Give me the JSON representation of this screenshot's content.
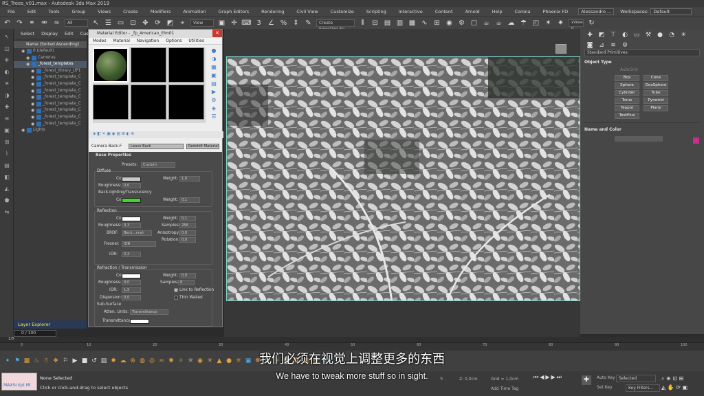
{
  "app": {
    "title": "RS_Trees_v01.max - Autodesk 3ds Max 2019"
  },
  "menubar": {
    "items": [
      "File",
      "Edit",
      "Tools",
      "Group",
      "Views",
      "Create",
      "Modifiers",
      "Animation",
      "Graph Editors",
      "Rendering",
      "Civil View",
      "Customize",
      "Scripting",
      "Interactive",
      "Content",
      "Arnold",
      "Help",
      "Corona",
      "Phoenix FD"
    ],
    "user": "Alessandro ...",
    "workspaces_label": "Workspaces:",
    "workspace_value": "Default"
  },
  "toolbar": {
    "filter_dd": "All",
    "view_dd": "View",
    "selection_set": "Create Selection Se",
    "xview": "xView: 0"
  },
  "scene_explorer": {
    "tabs": [
      "Select",
      "Display",
      "Edit",
      "Custo"
    ],
    "header": "Name (Sorted Ascending)",
    "rows": [
      {
        "label": "0 (default)",
        "indent": 1
      },
      {
        "label": "Cameras",
        "indent": 2
      },
      {
        "label": "_forest_templates",
        "indent": 2
      },
      {
        "label": "_forest_library_UP1",
        "indent": 3
      },
      {
        "label": "_forest_template_C",
        "indent": 3
      },
      {
        "label": "_forest_template_C",
        "indent": 3
      },
      {
        "label": "_forest_template_C",
        "indent": 3
      },
      {
        "label": "_forest_template_C",
        "indent": 3
      },
      {
        "label": "_forest_template_C",
        "indent": 3
      },
      {
        "label": "_forest_template_C",
        "indent": 3
      },
      {
        "label": "_forest_template_C",
        "indent": 3
      },
      {
        "label": "_forest_template_C",
        "indent": 3
      },
      {
        "label": "Lights",
        "indent": 1
      }
    ],
    "layer_explorer": "Layer Explorer",
    "frame": "0 / 100"
  },
  "material_editor": {
    "title": "Material Editor - _fp_American_Elm01",
    "menu": [
      "Modes",
      "Material",
      "Navigation",
      "Options",
      "Utilities"
    ],
    "name_label": "Camera Back-F",
    "material_name": "Leave Back",
    "material_type": "Redshift Material",
    "rollout": "Base Properties",
    "presets_label": "Presets:",
    "presets_value": "Custom",
    "diffuse": {
      "group": "Diffuse",
      "color_label": "Color:",
      "weight_label": "Weight:",
      "weight": "1,0",
      "roughness_label": "Roughness:",
      "roughness": "0,0"
    },
    "backlighting": {
      "group": "Back-lighting/Translucency",
      "color_label": "Color:",
      "weight_label": "Weight:",
      "weight": "0,1"
    },
    "reflection": {
      "group": "Reflection",
      "color_label": "Color:",
      "weight_label": "Weight:",
      "weight": "0,1",
      "roughness_label": "Roughness:",
      "roughness": "0,3",
      "samples_label": "Samples:",
      "samples": "256",
      "brdf_label": "BRDF:",
      "brdf": "Beck...nce)",
      "anisotropy_label": "Anisotropy:",
      "anisotropy": "0,0",
      "rotation_label": "Rotation:",
      "rotation": "0,0",
      "fresnel_label": "Fresnel:",
      "fresnel": "IOR",
      "ior_label": "IOR:",
      "ior": "2,2"
    },
    "refraction": {
      "group": "Refraction / Transmission",
      "color_label": "Color:",
      "weight_label": "Weight:",
      "weight": "0,0",
      "roughness_label": "Roughness:",
      "roughness": "0,0",
      "samples_label": "Samples:",
      "samples": "8",
      "ior_label": "IOR:",
      "ior": "1,5",
      "link_label": "Link to Reflection",
      "dispersion_label": "Dispersion:",
      "dispersion": "0,0",
      "thin_label": "Thin Walled"
    },
    "subsurface": {
      "group": "Sub-Surface",
      "atten_label": "Atten. Units:",
      "atten": "Transmittance",
      "transmittance_label": "Transmittance:"
    }
  },
  "command_panel": {
    "category": "Standard Primitives",
    "object_type": "Object Type",
    "autogrid": "AutoGrid",
    "objects": [
      "Box",
      "Cone",
      "Sphere",
      "GeoSphere",
      "Cylinder",
      "Tube",
      "Torus",
      "Pyramid",
      "Teapot",
      "Plane",
      "TextPlus"
    ],
    "name_color": "Name and Color"
  },
  "timeline": {
    "ticks": [
      "0",
      "10",
      "20",
      "30",
      "40",
      "50",
      "60",
      "70",
      "80",
      "90",
      "100"
    ],
    "frame_label": "1/5"
  },
  "status": {
    "maxscript": "MAXScript Mi",
    "none_selected": "None Selected",
    "prompt": "Click or click-and-drag to select objects",
    "x": "X:",
    "y": "Y:",
    "z": "Z: 0,0cm",
    "grid": "Grid = 1,0cm",
    "add_time_tag": "Add Time Tag",
    "auto_key": "Auto Key",
    "set_key": "Set Key",
    "selected": "Selected",
    "key_filters": "Key Filters..."
  },
  "subtitles": {
    "cn": "我们必须在视觉上调整更多的东西",
    "en": "We have to tweak more stuff so in sight."
  },
  "colors": {
    "accent_magenta": "#c5308c",
    "backlight_green": "#3fd62a",
    "viewport_border": "#7fd3c7"
  }
}
